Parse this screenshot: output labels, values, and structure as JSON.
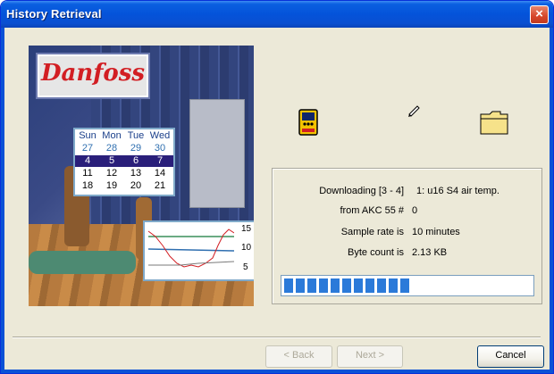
{
  "window": {
    "title": "History Retrieval",
    "close_glyph": "×"
  },
  "brand": {
    "logo_text": "Danfoss"
  },
  "calendar": {
    "days": [
      "Sun",
      "Mon",
      "Tue",
      "Wed"
    ],
    "rows": [
      [
        "27",
        "28",
        "29",
        "30"
      ],
      [
        "4",
        "5",
        "6",
        "7"
      ],
      [
        "11",
        "12",
        "13",
        "14"
      ],
      [
        "18",
        "19",
        "20",
        "21"
      ]
    ]
  },
  "trend_plot": {
    "labels": [
      "15",
      "10",
      "5"
    ]
  },
  "icons": [
    "handheld-device-icon",
    "pen-icon",
    "folder-icon"
  ],
  "status": {
    "downloading_label": "Downloading [3 - 4]",
    "downloading_value": "1: u16 S4 air temp.",
    "from_label": "from AKC 55 #",
    "from_value": "0",
    "sample_rate_label": "Sample rate is",
    "sample_rate_value": "10 minutes",
    "byte_count_label": "Byte count is",
    "byte_count_value": "2.13 KB",
    "progress_fraction": 0.54
  },
  "buttons": {
    "back": "< Back",
    "next": "Next >",
    "cancel": "Cancel"
  },
  "colors": {
    "title_bar": "#0a5fe0",
    "progress": "#2b7ad9",
    "logo_red": "#d21e23"
  }
}
